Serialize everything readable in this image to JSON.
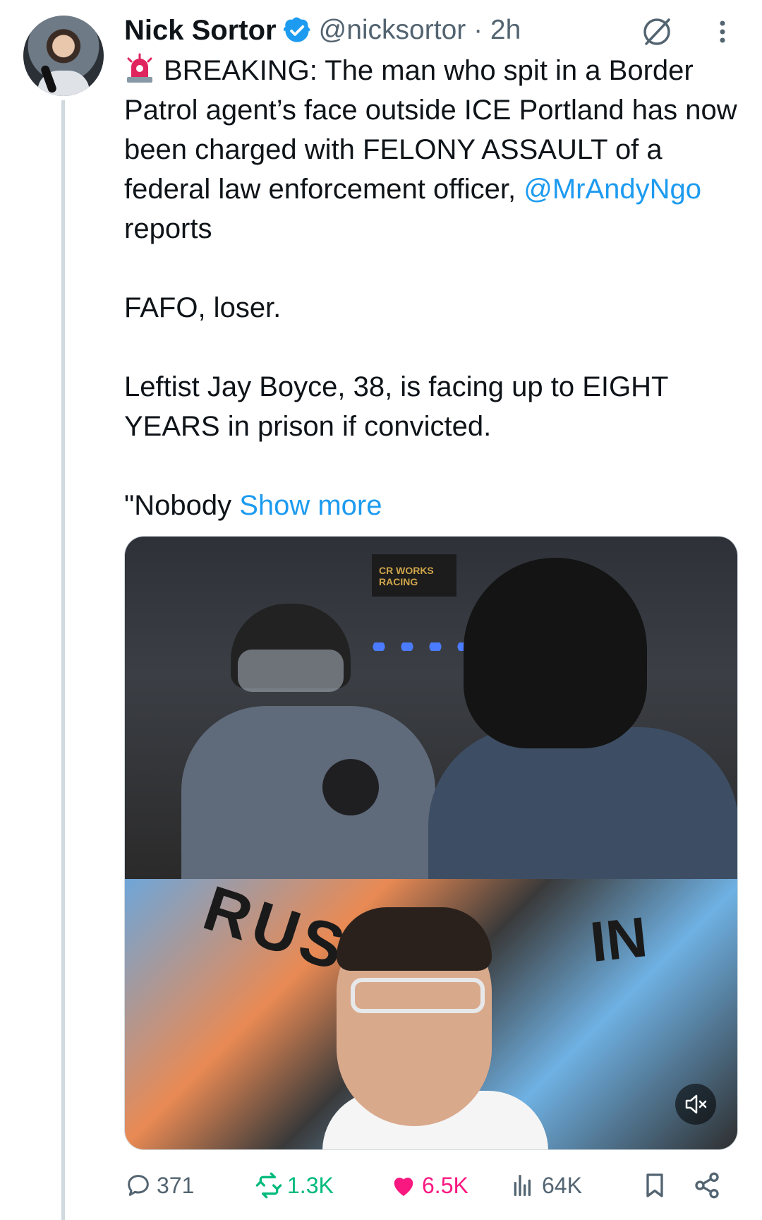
{
  "tweet": {
    "author_name": "Nick Sortor",
    "handle_time": "@nicksortor · 2h",
    "text_line_1": "BREAKING: The man who spit in a Border Patrol agent’s face outside ICE Portland has now been charged with FELONY ASSAULT of a federal law enforcement officer,",
    "mention": "@MrAndyNgo",
    "text_line_1_suffix": " reports",
    "para_2": "FAFO, loser.",
    "para_3": "Leftist Jay Boyce, 38, is facing up to EIGHT YEARS in prison if convicted.",
    "para_4_prefix": "\"Nobody ",
    "show_more": "Show more"
  },
  "media": {
    "sign_text": "CR WORKS RACING",
    "graffiti_left": "RUS",
    "graffiti_right": "IN"
  },
  "actions": {
    "replies": "371",
    "reposts": "1.3K",
    "likes": "6.5K",
    "views": "64K"
  },
  "colors": {
    "accent": "#1d9bf0",
    "repost": "#00ba7c",
    "like": "#f91880",
    "secondary_text": "#536471"
  },
  "icons": [
    "verified-badge-icon",
    "grok-icon",
    "more-icon",
    "siren-icon",
    "mute-icon",
    "reply-icon",
    "repost-icon",
    "like-icon",
    "views-icon",
    "bookmark-icon",
    "share-icon"
  ]
}
